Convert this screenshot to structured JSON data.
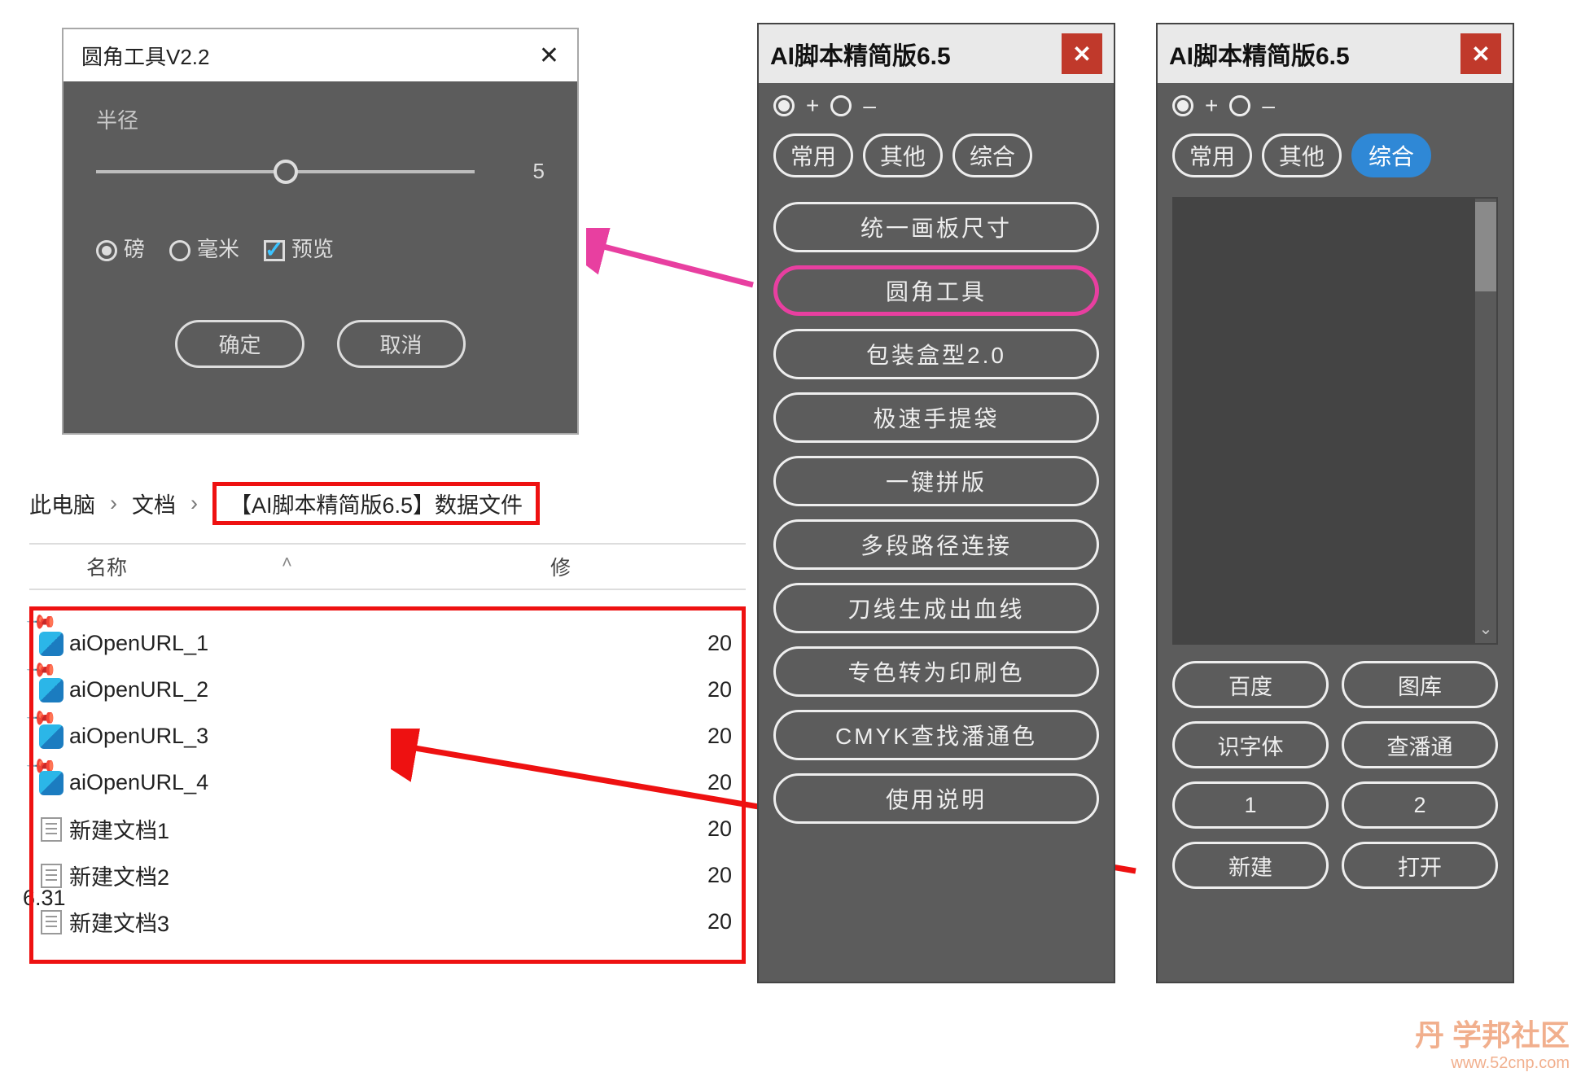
{
  "dialog": {
    "title": "圆角工具V2.2",
    "radius_label": "半径",
    "radius_value": "5",
    "unit_pt": "磅",
    "unit_mm": "毫米",
    "preview": "预览",
    "ok": "确定",
    "cancel": "取消"
  },
  "explorer": {
    "crumb1": "此电脑",
    "crumb2": "文档",
    "crumb3": "【AI脚本精简版6.5】数据文件",
    "col_name": "名称",
    "col_mod": "修",
    "files": [
      {
        "name": "aiOpenURL_1",
        "type": "url",
        "mod": "20"
      },
      {
        "name": "aiOpenURL_2",
        "type": "url",
        "mod": "20"
      },
      {
        "name": "aiOpenURL_3",
        "type": "url",
        "mod": "20"
      },
      {
        "name": "aiOpenURL_4",
        "type": "url",
        "mod": "20"
      },
      {
        "name": "新建文档1",
        "type": "txt",
        "mod": "20"
      },
      {
        "name": "新建文档2",
        "type": "txt",
        "mod": "20"
      },
      {
        "name": "新建文档3",
        "type": "txt",
        "mod": "20"
      }
    ],
    "version_text": "6.31"
  },
  "panel1": {
    "title": "AI脚本精简版6.5",
    "plus": "+",
    "minus": "–",
    "tabs": [
      "常用",
      "其他",
      "综合"
    ],
    "buttons": [
      "统一画板尺寸",
      "圆角工具",
      "包装盒型2.0",
      "极速手提袋",
      "一键拼版",
      "多段路径连接",
      "刀线生成出血线",
      "专色转为印刷色",
      "CMYK查找潘通色",
      "使用说明"
    ]
  },
  "panel2": {
    "title": "AI脚本精简版6.5",
    "plus": "+",
    "minus": "–",
    "tabs": [
      "常用",
      "其他",
      "综合"
    ],
    "links": [
      "百度",
      "图库",
      "识字体",
      "查潘通",
      "1",
      "2",
      "新建",
      "打开"
    ]
  },
  "watermark": {
    "logo": "丹 学邦社区",
    "url": "www.52cnp.com"
  }
}
